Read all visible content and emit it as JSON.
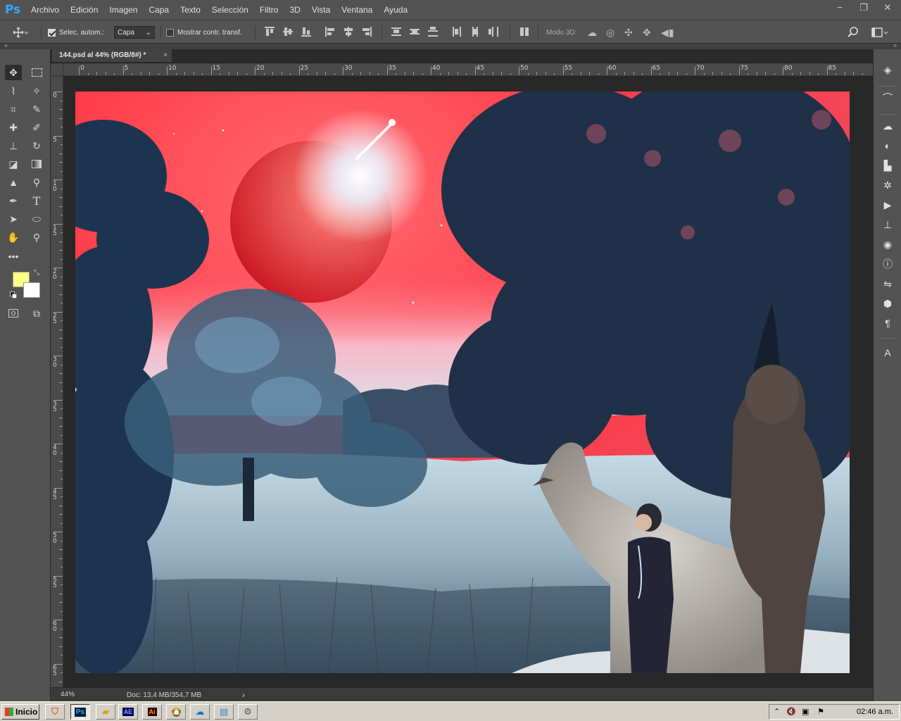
{
  "app": {
    "logo": "Ps",
    "menus": [
      "Archivo",
      "Edición",
      "Imagen",
      "Capa",
      "Texto",
      "Selección",
      "Filtro",
      "3D",
      "Vista",
      "Ventana",
      "Ayuda"
    ],
    "window_controls": [
      "−",
      "❐",
      "✕"
    ]
  },
  "options": {
    "auto_select_label": "Selec. autom.:",
    "auto_select_checked": true,
    "layer_select_value": "Capa",
    "show_transform_label": "Mostrar contr. transf.",
    "show_transform_checked": false,
    "mode3d_label": "Modo 3D:"
  },
  "document": {
    "tab_title": "144.psd al 44% (RGB/8#) *",
    "close_glyph": "×"
  },
  "rulers": {
    "top": [
      "0",
      "5",
      "10",
      "15",
      "20",
      "25",
      "30",
      "35",
      "40",
      "45",
      "50",
      "55",
      "60",
      "65",
      "70",
      "75",
      "80",
      "85"
    ],
    "left": [
      "0",
      "5",
      "10",
      "15",
      "20",
      "25",
      "30",
      "35",
      "40",
      "45",
      "50",
      "55",
      "60",
      "65"
    ]
  },
  "status": {
    "zoom": "44%",
    "doc_info": "Doc: 13,4 MB/354,7 MB",
    "arrow": "›"
  },
  "colors": {
    "foreground": "#ffff80",
    "background": "#ffffff",
    "accent": "#31a8ff"
  },
  "tools": [
    "move-tool-icon",
    "marquee-tool-icon",
    "lasso-tool-icon",
    "magic-wand-tool-icon",
    "crop-tool-icon",
    "eyedropper-tool-icon",
    "healing-brush-tool-icon",
    "brush-tool-icon",
    "clone-stamp-tool-icon",
    "history-brush-tool-icon",
    "eraser-tool-icon",
    "gradient-tool-icon",
    "blur-tool-icon",
    "dodge-tool-icon",
    "pen-tool-icon",
    "type-tool-icon",
    "path-selection-tool-icon",
    "ellipse-tool-icon",
    "hand-tool-icon",
    "zoom-tool-icon",
    "more-tools-icon",
    "quick-mask-icon",
    "screen-mode-icon"
  ],
  "right_panel": [
    "layers-panel-icon",
    "paths-panel-icon",
    "libraries-panel-icon",
    "adjustments-panel-icon",
    "histogram-panel-icon",
    "brush-settings-icon",
    "actions-panel-icon",
    "clone-source-icon",
    "channels-panel-icon",
    "info-panel-icon",
    "history-panel-icon",
    "3d-panel-icon",
    "paragraph-panel-icon",
    "character-panel-icon"
  ],
  "taskbar": {
    "start_label": "Inicio",
    "apps": [
      "brave-icon",
      "photoshop-icon",
      "explorer-icon",
      "after-effects-icon",
      "illustrator-icon",
      "chrome-icon",
      "onedrive-icon",
      "notepad-icon",
      "settings-icon"
    ],
    "app_labels": {
      "photoshop": "Ps",
      "after_effects": "AE",
      "illustrator": "Ai"
    },
    "clock": "02:46 a.m."
  }
}
